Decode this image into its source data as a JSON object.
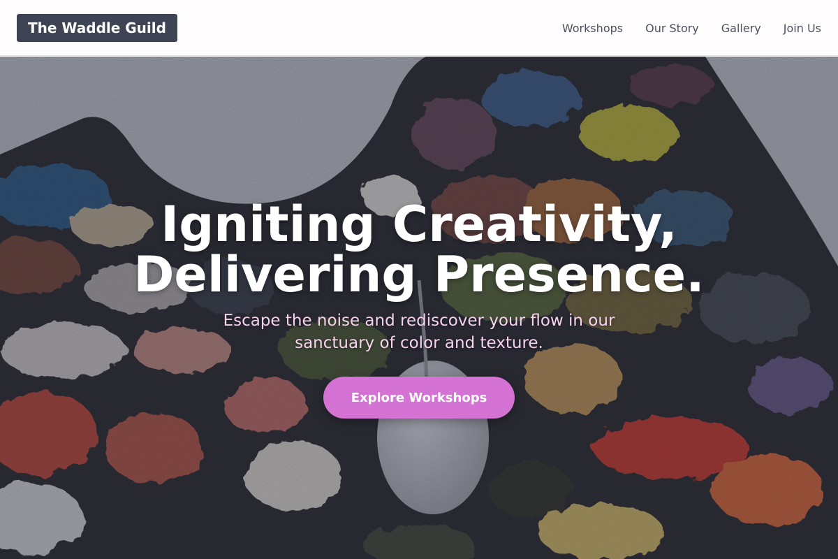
{
  "site": {
    "logo_text": "The Waddle Guild"
  },
  "nav": {
    "items": [
      {
        "label": "Workshops"
      },
      {
        "label": "Our Story"
      },
      {
        "label": "Gallery"
      },
      {
        "label": "Join Us"
      }
    ]
  },
  "hero": {
    "headline_line1": "Igniting Creativity,",
    "headline_line2": "Delivering Presence.",
    "subhead_line1": "Escape the noise and rediscover your flow in our",
    "subhead_line2": "sanctuary of color and texture.",
    "cta_label": "Explore Workshops",
    "background_image": "paint-palette-photo"
  },
  "colors": {
    "header_bg": "#fefcfd",
    "logo_bg": "#3e4454",
    "nav_text": "#4b5160",
    "cta_bg": "#d473d4",
    "subhead_text": "#f7d2ee"
  }
}
